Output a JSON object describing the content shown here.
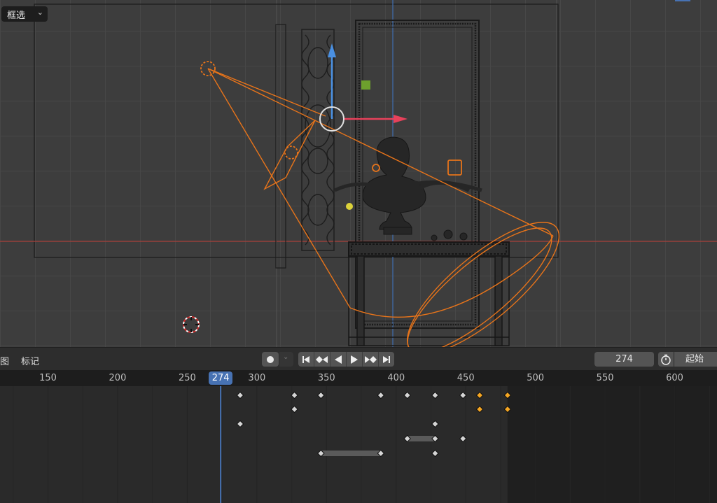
{
  "viewport": {
    "select_mode": {
      "label": "框选",
      "icon": "chevron-down-icon"
    }
  },
  "timeline": {
    "menu": [
      "图",
      "标记"
    ],
    "playback": {
      "icons": [
        "jump-to-start-icon",
        "previous-keyframe-icon",
        "play-reverse-icon",
        "play-icon",
        "next-keyframe-icon",
        "jump-to-end-icon"
      ]
    },
    "current_frame": "274",
    "start_label": "起始"
  },
  "ruler": {
    "labels": [
      "150",
      "200",
      "250",
      "300",
      "350",
      "400",
      "450",
      "500",
      "550",
      "600"
    ],
    "frames": [
      150,
      200,
      250,
      300,
      350,
      400,
      450,
      500,
      550,
      600
    ],
    "current_label": "274",
    "current": 274,
    "scene_end": 480
  },
  "keyframes": {
    "rows": [
      {
        "frames": [
          288,
          327,
          346,
          389,
          408,
          428,
          448,
          460,
          480
        ],
        "selected": [
          460,
          480
        ]
      },
      {
        "frames": [
          327,
          460,
          480
        ],
        "selected": [
          460,
          480
        ]
      },
      {
        "frames": [
          288,
          428
        ],
        "selected": []
      },
      {
        "frames": [
          408,
          428,
          448
        ],
        "selected": [],
        "hold": [
          408,
          428
        ]
      },
      {
        "frames": [
          346,
          389,
          428
        ],
        "selected": [],
        "hold": [
          346,
          389
        ]
      }
    ]
  },
  "colors": {
    "accent": "#4772b3",
    "keyframe": "#d5d5d5",
    "keyframe_selected": "#f5a623",
    "x_axis": "#c0392b",
    "selection": "#e8741a"
  }
}
